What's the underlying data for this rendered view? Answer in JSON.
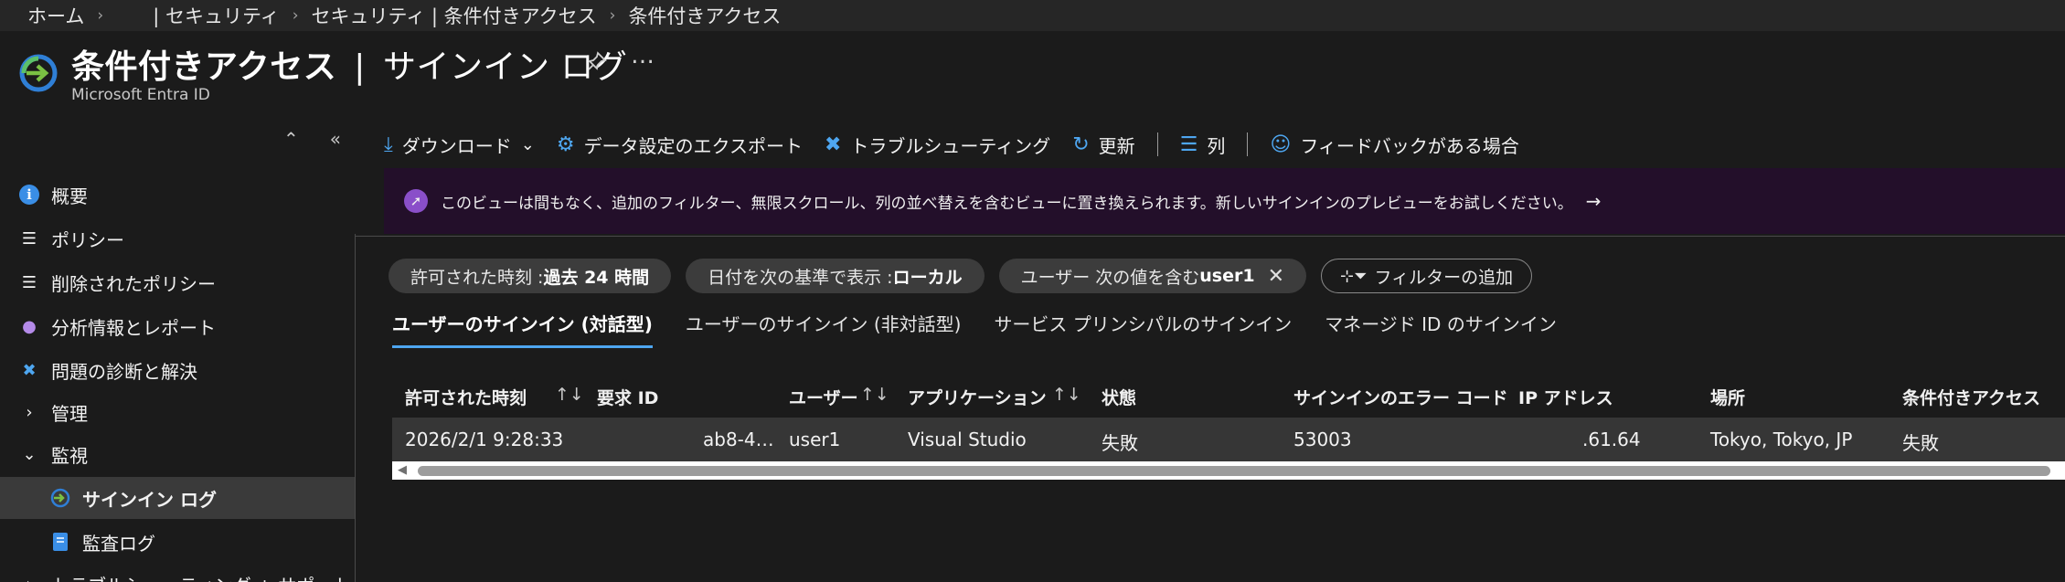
{
  "breadcrumb": {
    "home": "ホーム",
    "items": [
      "| セキュリティ",
      "セキュリティ | 条件付きアクセス",
      "条件付きアクセス"
    ]
  },
  "header": {
    "title": "条件付きアクセス",
    "separator": "|",
    "subtitle_page": "サインイン ログ",
    "service": "Microsoft Entra ID",
    "more": "…"
  },
  "nav": {
    "items": [
      {
        "label": "概要",
        "icon": "info-icon"
      },
      {
        "label": "ポリシー",
        "icon": "list-icon"
      },
      {
        "label": "削除されたポリシー",
        "icon": "list-icon"
      },
      {
        "label": "分析情報とレポート",
        "icon": "lightbulb-icon"
      },
      {
        "label": "問題の診断と解決",
        "icon": "wrench-icon"
      },
      {
        "label": "管理",
        "icon": "chevron-right-icon"
      },
      {
        "label": "監視",
        "icon": "chevron-down-icon"
      },
      {
        "label": "サインイン ログ",
        "icon": "signin-icon"
      },
      {
        "label": "監査ログ",
        "icon": "audit-log-icon"
      },
      {
        "label": "トラブルシューティング + サポート",
        "icon": "chevron-right-icon"
      }
    ]
  },
  "toolbar": {
    "download": "ダウンロード",
    "export": "データ設定のエクスポート",
    "troubleshoot": "トラブルシューティング",
    "refresh": "更新",
    "columns": "列",
    "feedback": "フィードバックがある場合"
  },
  "banner": {
    "text": "このビューは間もなく、追加のフィルター、無限スクロール、列の並べ替えを含むビューに置き換えられます。新しいサインインのプレビューをお試しください。",
    "arrow": "→"
  },
  "filters": {
    "time_label": "許可された時刻 : ",
    "time_value": "過去 24 時間",
    "date_label": "日付を次の基準で表示 : ",
    "date_value": "ローカル",
    "user_label": "ユーザー 次の値を含む ",
    "user_value": "user1",
    "add_filter": "フィルターの追加"
  },
  "tabs": [
    "ユーザーのサインイン (対話型)",
    "ユーザーのサインイン (非対話型)",
    "サービス プリンシパルのサインイン",
    "マネージド ID のサインイン"
  ],
  "table": {
    "columns": [
      "許可された時刻",
      "要求 ID",
      "ユーザー",
      "アプリケーション",
      "状態",
      "サインインのエラー コード",
      "IP アドレス",
      "場所",
      "条件付きアクセス"
    ],
    "sort_glyph": "↑↓",
    "rows": [
      {
        "time": "2026/2/1 9:28:33",
        "request_id": "ab8-4…",
        "user": "user1",
        "app": "Visual Studio",
        "status": "失敗",
        "error_code": "53003",
        "ip": ".61.64",
        "location": "Tokyo, Tokyo, JP",
        "ca": "失敗"
      }
    ]
  },
  "colors": {
    "accent": "#4ea6f0",
    "banner_bg": "#230f2a",
    "background": "#1b1b1b"
  }
}
